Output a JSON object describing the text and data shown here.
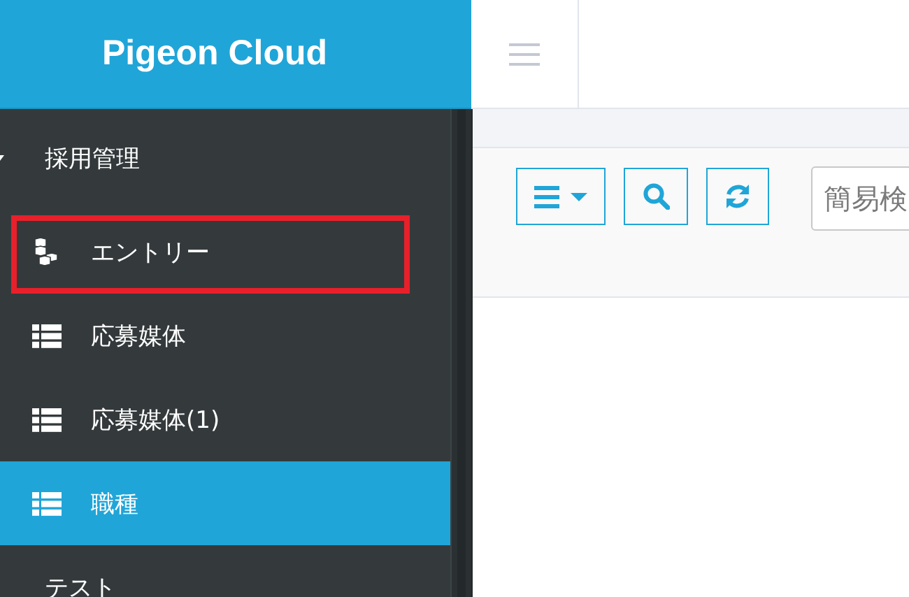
{
  "header": {
    "brand": "Pigeon Cloud"
  },
  "sidebar": {
    "items": [
      {
        "kind": "heading",
        "label": "採用管理"
      },
      {
        "kind": "entry",
        "label": "エントリー",
        "selected": false,
        "highlighted": true
      },
      {
        "kind": "table",
        "label": "応募媒体",
        "selected": false,
        "highlighted": false
      },
      {
        "kind": "table",
        "label": "応募媒体(1)",
        "selected": false,
        "highlighted": false
      },
      {
        "kind": "table",
        "label": "職種",
        "selected": true,
        "highlighted": false
      },
      {
        "kind": "heading",
        "label": "テスト"
      }
    ]
  },
  "toolbar": {
    "search": {
      "placeholder": "簡易検"
    }
  }
}
